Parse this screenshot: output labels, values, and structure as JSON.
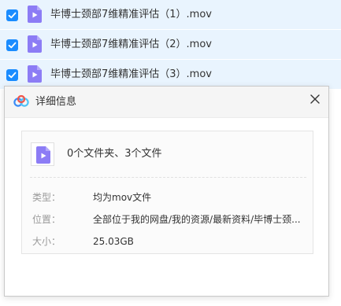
{
  "file_list": {
    "rows": [
      {
        "name": "毕博士颈部7维精准评估（1）.mov",
        "checked": true
      },
      {
        "name": "毕博士颈部7维精准评估（2）.mov",
        "checked": true
      },
      {
        "name": "毕博士颈部7维精准评估（3）.mov",
        "checked": true
      }
    ]
  },
  "dialog": {
    "title": "详细信息",
    "summary": "0个文件夹、3个文件",
    "properties": {
      "type_label": "类型：",
      "type_value": "均为mov文件",
      "location_label": "位置：",
      "location_value": "全部位于我的网盘/我的资源/最新资料/毕博士颈...",
      "size_label": "大小：",
      "size_value": "25.03GB"
    }
  },
  "colors": {
    "row_selected_bg": "#e9f4fe",
    "checkbox": "#1a8cff",
    "video_icon": "#8c7cf5",
    "logo_blue": "#3b8cf6"
  },
  "icons": {
    "row_checkbox": "checkbox-checked-icon",
    "row_file": "video-file-icon",
    "dialog_logo": "baidu-netdisk-logo-icon",
    "dialog_close": "close-icon",
    "summary_file": "video-file-icon"
  }
}
